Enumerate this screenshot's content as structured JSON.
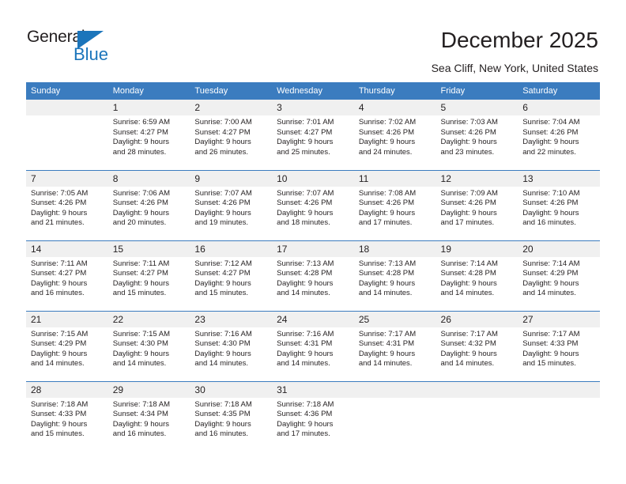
{
  "brand": {
    "name_top": "General",
    "name_bottom": "Blue",
    "triangle_color": "#1b75bb"
  },
  "header": {
    "title": "December 2025",
    "subtitle": "Sea Cliff, New York, United States"
  },
  "theme": {
    "header_blue": "#3b7cbf",
    "daynum_gray": "#f0f0f0",
    "text": "#231f20"
  },
  "weekday_headers": [
    "Sunday",
    "Monday",
    "Tuesday",
    "Wednesday",
    "Thursday",
    "Friday",
    "Saturday"
  ],
  "labels": {
    "sunrise_prefix": "Sunrise:",
    "sunset_prefix": "Sunset:",
    "daylight_prefix": "Daylight:"
  },
  "weeks": [
    [
      {
        "day": "",
        "empty": true
      },
      {
        "day": "1",
        "sunrise": "Sunrise: 6:59 AM",
        "sunset": "Sunset: 4:27 PM",
        "daylight1": "Daylight: 9 hours",
        "daylight2": "and 28 minutes."
      },
      {
        "day": "2",
        "sunrise": "Sunrise: 7:00 AM",
        "sunset": "Sunset: 4:27 PM",
        "daylight1": "Daylight: 9 hours",
        "daylight2": "and 26 minutes."
      },
      {
        "day": "3",
        "sunrise": "Sunrise: 7:01 AM",
        "sunset": "Sunset: 4:27 PM",
        "daylight1": "Daylight: 9 hours",
        "daylight2": "and 25 minutes."
      },
      {
        "day": "4",
        "sunrise": "Sunrise: 7:02 AM",
        "sunset": "Sunset: 4:26 PM",
        "daylight1": "Daylight: 9 hours",
        "daylight2": "and 24 minutes."
      },
      {
        "day": "5",
        "sunrise": "Sunrise: 7:03 AM",
        "sunset": "Sunset: 4:26 PM",
        "daylight1": "Daylight: 9 hours",
        "daylight2": "and 23 minutes."
      },
      {
        "day": "6",
        "sunrise": "Sunrise: 7:04 AM",
        "sunset": "Sunset: 4:26 PM",
        "daylight1": "Daylight: 9 hours",
        "daylight2": "and 22 minutes."
      }
    ],
    [
      {
        "day": "7",
        "sunrise": "Sunrise: 7:05 AM",
        "sunset": "Sunset: 4:26 PM",
        "daylight1": "Daylight: 9 hours",
        "daylight2": "and 21 minutes."
      },
      {
        "day": "8",
        "sunrise": "Sunrise: 7:06 AM",
        "sunset": "Sunset: 4:26 PM",
        "daylight1": "Daylight: 9 hours",
        "daylight2": "and 20 minutes."
      },
      {
        "day": "9",
        "sunrise": "Sunrise: 7:07 AM",
        "sunset": "Sunset: 4:26 PM",
        "daylight1": "Daylight: 9 hours",
        "daylight2": "and 19 minutes."
      },
      {
        "day": "10",
        "sunrise": "Sunrise: 7:07 AM",
        "sunset": "Sunset: 4:26 PM",
        "daylight1": "Daylight: 9 hours",
        "daylight2": "and 18 minutes."
      },
      {
        "day": "11",
        "sunrise": "Sunrise: 7:08 AM",
        "sunset": "Sunset: 4:26 PM",
        "daylight1": "Daylight: 9 hours",
        "daylight2": "and 17 minutes."
      },
      {
        "day": "12",
        "sunrise": "Sunrise: 7:09 AM",
        "sunset": "Sunset: 4:26 PM",
        "daylight1": "Daylight: 9 hours",
        "daylight2": "and 17 minutes."
      },
      {
        "day": "13",
        "sunrise": "Sunrise: 7:10 AM",
        "sunset": "Sunset: 4:26 PM",
        "daylight1": "Daylight: 9 hours",
        "daylight2": "and 16 minutes."
      }
    ],
    [
      {
        "day": "14",
        "sunrise": "Sunrise: 7:11 AM",
        "sunset": "Sunset: 4:27 PM",
        "daylight1": "Daylight: 9 hours",
        "daylight2": "and 16 minutes."
      },
      {
        "day": "15",
        "sunrise": "Sunrise: 7:11 AM",
        "sunset": "Sunset: 4:27 PM",
        "daylight1": "Daylight: 9 hours",
        "daylight2": "and 15 minutes."
      },
      {
        "day": "16",
        "sunrise": "Sunrise: 7:12 AM",
        "sunset": "Sunset: 4:27 PM",
        "daylight1": "Daylight: 9 hours",
        "daylight2": "and 15 minutes."
      },
      {
        "day": "17",
        "sunrise": "Sunrise: 7:13 AM",
        "sunset": "Sunset: 4:28 PM",
        "daylight1": "Daylight: 9 hours",
        "daylight2": "and 14 minutes."
      },
      {
        "day": "18",
        "sunrise": "Sunrise: 7:13 AM",
        "sunset": "Sunset: 4:28 PM",
        "daylight1": "Daylight: 9 hours",
        "daylight2": "and 14 minutes."
      },
      {
        "day": "19",
        "sunrise": "Sunrise: 7:14 AM",
        "sunset": "Sunset: 4:28 PM",
        "daylight1": "Daylight: 9 hours",
        "daylight2": "and 14 minutes."
      },
      {
        "day": "20",
        "sunrise": "Sunrise: 7:14 AM",
        "sunset": "Sunset: 4:29 PM",
        "daylight1": "Daylight: 9 hours",
        "daylight2": "and 14 minutes."
      }
    ],
    [
      {
        "day": "21",
        "sunrise": "Sunrise: 7:15 AM",
        "sunset": "Sunset: 4:29 PM",
        "daylight1": "Daylight: 9 hours",
        "daylight2": "and 14 minutes."
      },
      {
        "day": "22",
        "sunrise": "Sunrise: 7:15 AM",
        "sunset": "Sunset: 4:30 PM",
        "daylight1": "Daylight: 9 hours",
        "daylight2": "and 14 minutes."
      },
      {
        "day": "23",
        "sunrise": "Sunrise: 7:16 AM",
        "sunset": "Sunset: 4:30 PM",
        "daylight1": "Daylight: 9 hours",
        "daylight2": "and 14 minutes."
      },
      {
        "day": "24",
        "sunrise": "Sunrise: 7:16 AM",
        "sunset": "Sunset: 4:31 PM",
        "daylight1": "Daylight: 9 hours",
        "daylight2": "and 14 minutes."
      },
      {
        "day": "25",
        "sunrise": "Sunrise: 7:17 AM",
        "sunset": "Sunset: 4:31 PM",
        "daylight1": "Daylight: 9 hours",
        "daylight2": "and 14 minutes."
      },
      {
        "day": "26",
        "sunrise": "Sunrise: 7:17 AM",
        "sunset": "Sunset: 4:32 PM",
        "daylight1": "Daylight: 9 hours",
        "daylight2": "and 14 minutes."
      },
      {
        "day": "27",
        "sunrise": "Sunrise: 7:17 AM",
        "sunset": "Sunset: 4:33 PM",
        "daylight1": "Daylight: 9 hours",
        "daylight2": "and 15 minutes."
      }
    ],
    [
      {
        "day": "28",
        "sunrise": "Sunrise: 7:18 AM",
        "sunset": "Sunset: 4:33 PM",
        "daylight1": "Daylight: 9 hours",
        "daylight2": "and 15 minutes."
      },
      {
        "day": "29",
        "sunrise": "Sunrise: 7:18 AM",
        "sunset": "Sunset: 4:34 PM",
        "daylight1": "Daylight: 9 hours",
        "daylight2": "and 16 minutes."
      },
      {
        "day": "30",
        "sunrise": "Sunrise: 7:18 AM",
        "sunset": "Sunset: 4:35 PM",
        "daylight1": "Daylight: 9 hours",
        "daylight2": "and 16 minutes."
      },
      {
        "day": "31",
        "sunrise": "Sunrise: 7:18 AM",
        "sunset": "Sunset: 4:36 PM",
        "daylight1": "Daylight: 9 hours",
        "daylight2": "and 17 minutes."
      },
      {
        "day": "",
        "empty": true
      },
      {
        "day": "",
        "empty": true
      },
      {
        "day": "",
        "empty": true
      }
    ]
  ]
}
